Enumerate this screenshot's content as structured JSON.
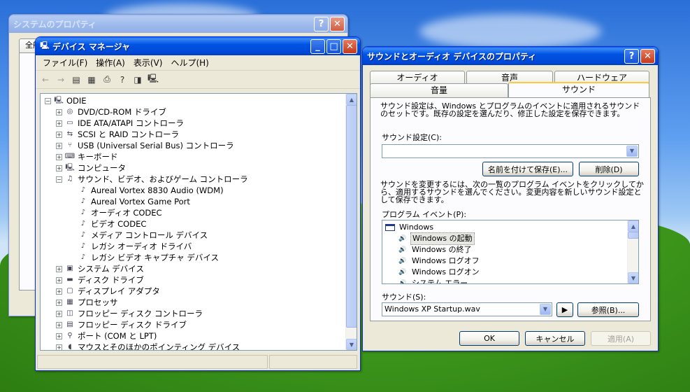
{
  "desktop": {
    "colors": {
      "sky": "#5f9ff0",
      "grass": "#3f9a1d"
    }
  },
  "system_props": {
    "title": "システムのプロパティ",
    "tab_partial": "全般"
  },
  "device_manager": {
    "title": "デバイス マネージャ",
    "menu": [
      "ファイル(F)",
      "操作(A)",
      "表示(V)",
      "ヘルプ(H)"
    ],
    "root": "ODIE",
    "tree": [
      {
        "label": "DVD/CD-ROM ドライブ",
        "icon": "cdrom-icon",
        "level": 1,
        "state": "+"
      },
      {
        "label": "IDE ATA/ATAPI コントローラ",
        "icon": "ide-icon",
        "level": 1,
        "state": "+"
      },
      {
        "label": "SCSI と RAID コントローラ",
        "icon": "scsi-icon",
        "level": 1,
        "state": "+"
      },
      {
        "label": "USB (Universal Serial Bus) コントローラ",
        "icon": "usb-icon",
        "level": 1,
        "state": "+"
      },
      {
        "label": "キーボード",
        "icon": "keyboard-icon",
        "level": 1,
        "state": "+"
      },
      {
        "label": "コンピュータ",
        "icon": "computer-icon",
        "level": 1,
        "state": "+"
      },
      {
        "label": "サウンド、ビデオ、およびゲーム コントローラ",
        "icon": "sound-icon",
        "level": 1,
        "state": "-"
      },
      {
        "label": "Aureal Vortex 8830 Audio (WDM)",
        "icon": "sound-device-icon",
        "level": 2,
        "state": ""
      },
      {
        "label": "Aureal Vortex Game Port",
        "icon": "sound-device-icon",
        "level": 2,
        "state": ""
      },
      {
        "label": "オーディオ CODEC",
        "icon": "sound-device-icon",
        "level": 2,
        "state": ""
      },
      {
        "label": "ビデオ CODEC",
        "icon": "sound-device-icon",
        "level": 2,
        "state": ""
      },
      {
        "label": "メディア コントロール デバイス",
        "icon": "sound-device-icon",
        "level": 2,
        "state": ""
      },
      {
        "label": "レガシ オーディオ ドライバ",
        "icon": "sound-device-icon",
        "level": 2,
        "state": ""
      },
      {
        "label": "レガシ ビデオ キャプチャ デバイス",
        "icon": "sound-device-icon",
        "level": 2,
        "state": ""
      },
      {
        "label": "システム デバイス",
        "icon": "system-device-icon",
        "level": 1,
        "state": "+"
      },
      {
        "label": "ディスク ドライブ",
        "icon": "disk-icon",
        "level": 1,
        "state": "+"
      },
      {
        "label": "ディスプレイ アダプタ",
        "icon": "display-icon",
        "level": 1,
        "state": "+"
      },
      {
        "label": "プロセッサ",
        "icon": "processor-icon",
        "level": 1,
        "state": "+"
      },
      {
        "label": "フロッピー ディスク コントローラ",
        "icon": "floppy-controller-icon",
        "level": 1,
        "state": "+"
      },
      {
        "label": "フロッピー ディスク ドライブ",
        "icon": "floppy-icon",
        "level": 1,
        "state": "+"
      },
      {
        "label": "ポート (COM と LPT)",
        "icon": "port-icon",
        "level": 1,
        "state": "+"
      },
      {
        "label": "マウスとそのほかのポインティング デバイス",
        "icon": "mouse-icon",
        "level": 1,
        "state": "+"
      }
    ]
  },
  "sound_dialog": {
    "title": "サウンドとオーディオ デバイスのプロパティ",
    "tabs_back": [
      "オーディオ",
      "音声",
      "ハードウェア"
    ],
    "tabs_front": [
      "音量",
      "サウンド"
    ],
    "description": "サウンド設定は、Windows とプログラムのイベントに適用されるサウンドのセットです。既存の設定を選んだり、修正した設定を保存できます。",
    "scheme_label": "サウンド設定(C):",
    "scheme_value": "",
    "save_as": "名前を付けて保存(E)...",
    "delete": "削除(D)",
    "change_desc": "サウンドを変更するには、次の一覧のプログラム イベントをクリックしてから、適用するサウンドを選んでください。変更内容を新しいサウンド設定として保存できます。",
    "events_label": "プログラム イベント(P):",
    "events_group": "Windows",
    "events": [
      "Windows の起動",
      "Windows の終了",
      "Windows ログオフ",
      "Windows ログオン",
      "システム エラー"
    ],
    "sound_label": "サウンド(S):",
    "sound_value": "Windows XP Startup.wav",
    "browse": "参照(B)...",
    "ok": "OK",
    "cancel": "キャンセル",
    "apply": "適用(A)"
  }
}
